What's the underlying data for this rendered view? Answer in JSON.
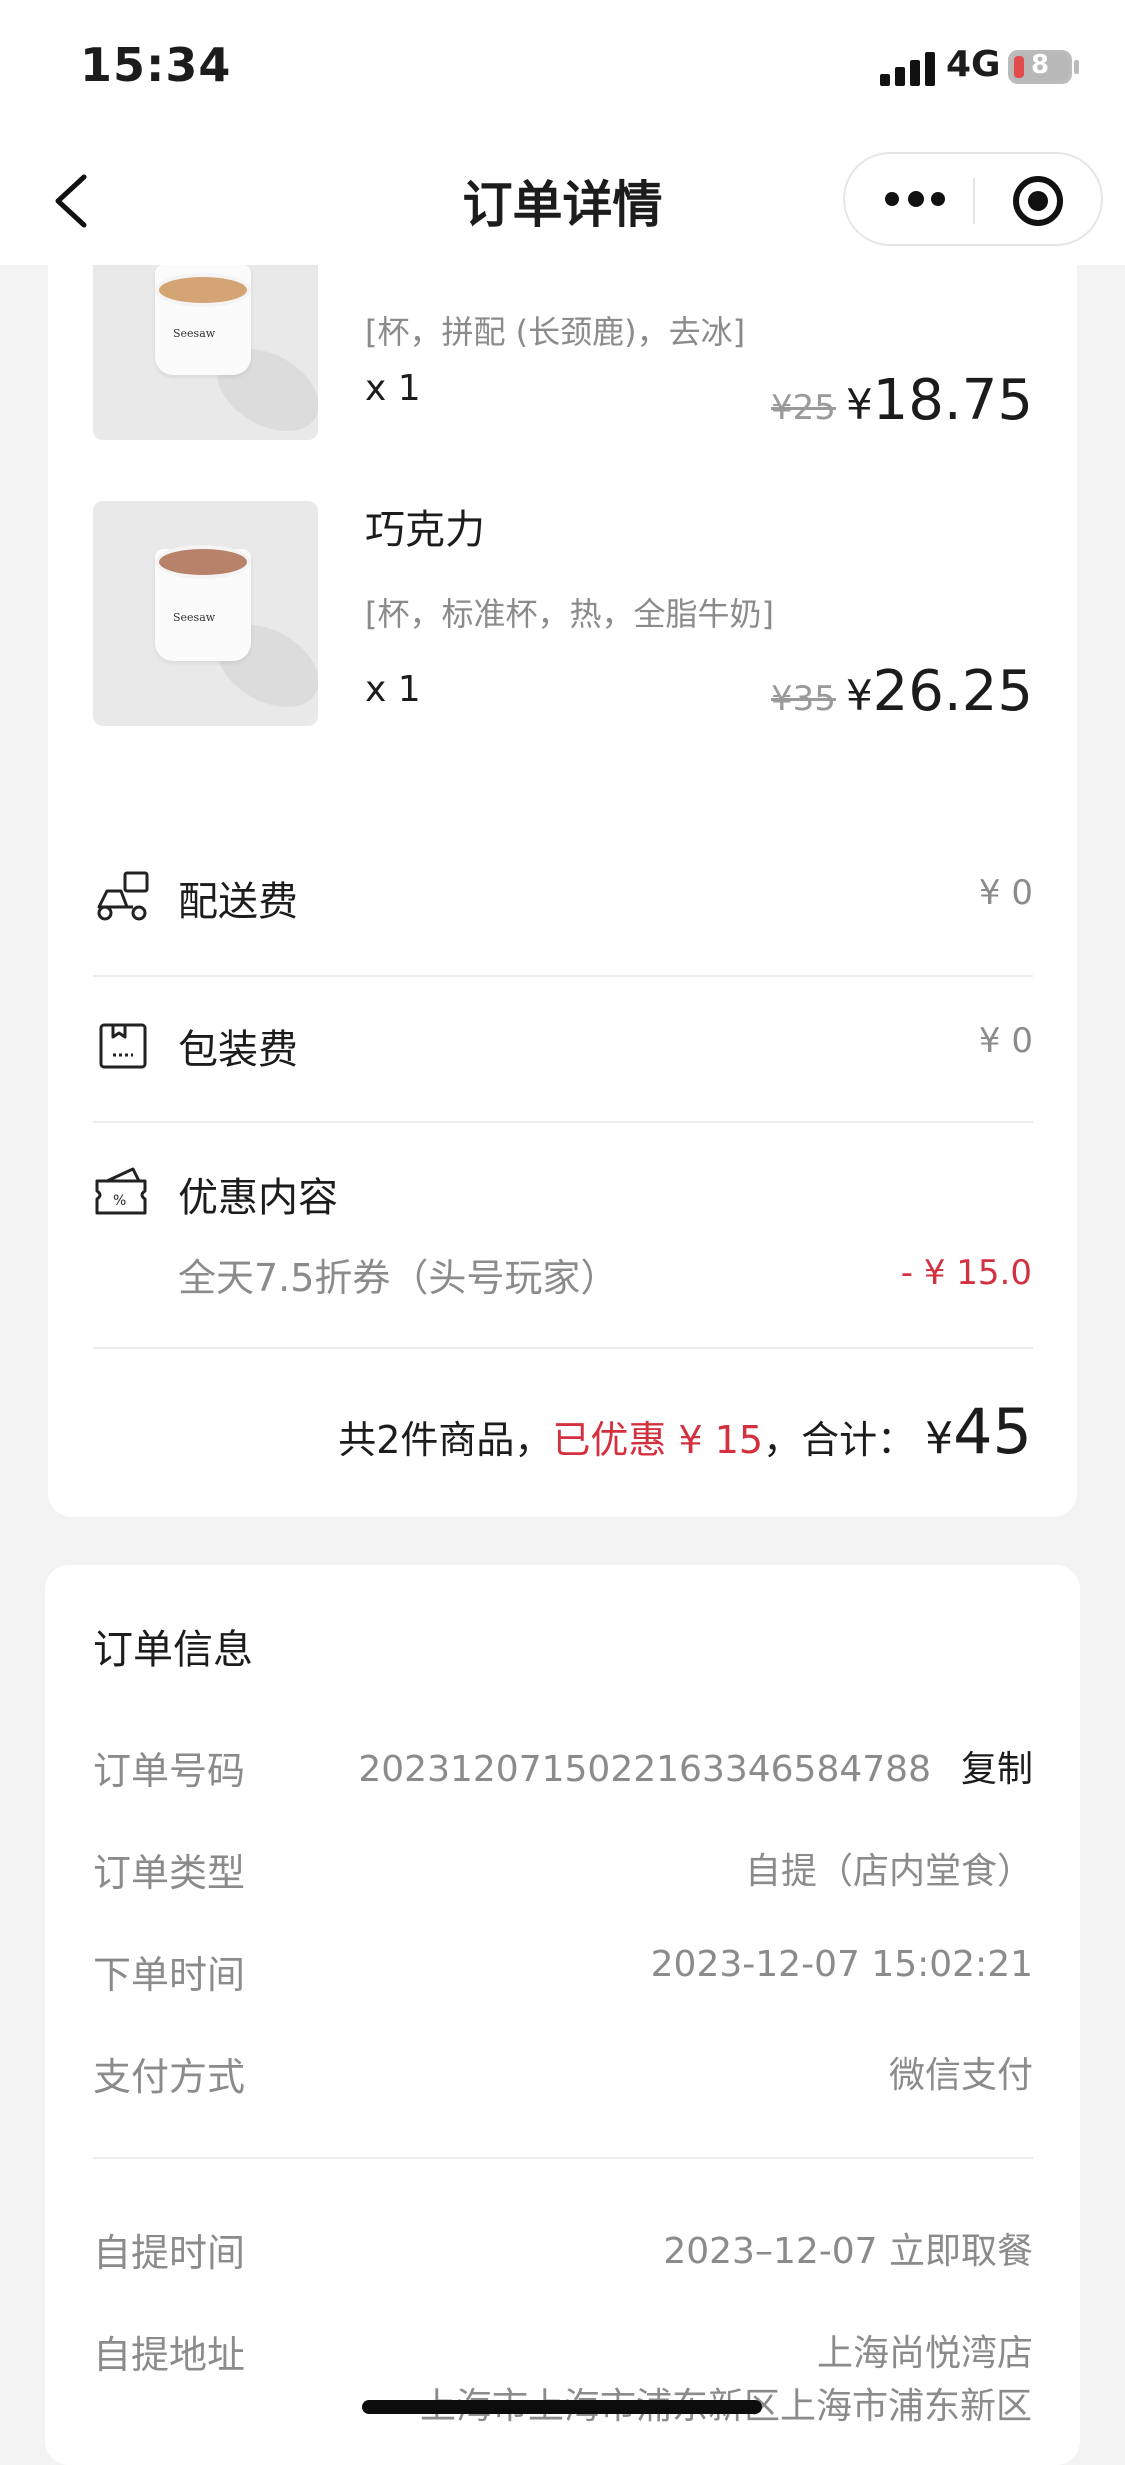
{
  "status_bar": {
    "time": "15:34",
    "network": "4G",
    "battery": "8"
  },
  "nav": {
    "title": "订单详情"
  },
  "products": [
    {
      "name": "",
      "spec": "[杯，拼配 (长颈鹿)，去冰]",
      "qty": "x 1",
      "orig_price": "¥25",
      "currency": "¥",
      "price": "18.75"
    },
    {
      "name": "巧克力",
      "spec": "[杯，标准杯，热，全脂牛奶]",
      "qty": "x 1",
      "orig_price": "¥35",
      "currency": "¥",
      "price": "26.25"
    }
  ],
  "fees": {
    "delivery_label": "配送费",
    "delivery_value": "¥ 0",
    "packaging_label": "包装费",
    "packaging_value": "¥ 0",
    "discount_label": "优惠内容",
    "discount_desc": "全天7.5折券（头号玩家）",
    "discount_value": "- ¥ 15.0"
  },
  "total": {
    "prefix": "共2件商品，",
    "saved": "已优惠 ¥ 15",
    "mid": "，合计：",
    "currency": "¥",
    "amount": "45"
  },
  "order_info": {
    "title": "订单信息",
    "number_label": "订单号码",
    "number_value": "202312071502216334658478​8",
    "copy_label": "复制",
    "type_label": "订单类型",
    "type_value": "自提（店内堂食）",
    "time_label": "下单时间",
    "time_value": "2023-12-07 15:02:21",
    "pay_label": "支付方式",
    "pay_value": "微信支付",
    "pickup_time_label": "自提时间",
    "pickup_time_value": "2023–12-07  立即取餐",
    "pickup_addr_label": "自提地址",
    "pickup_addr_value": "上海尚悦湾店",
    "pickup_addr_detail": "上海市上海市浦东新区上海市浦东新区"
  }
}
